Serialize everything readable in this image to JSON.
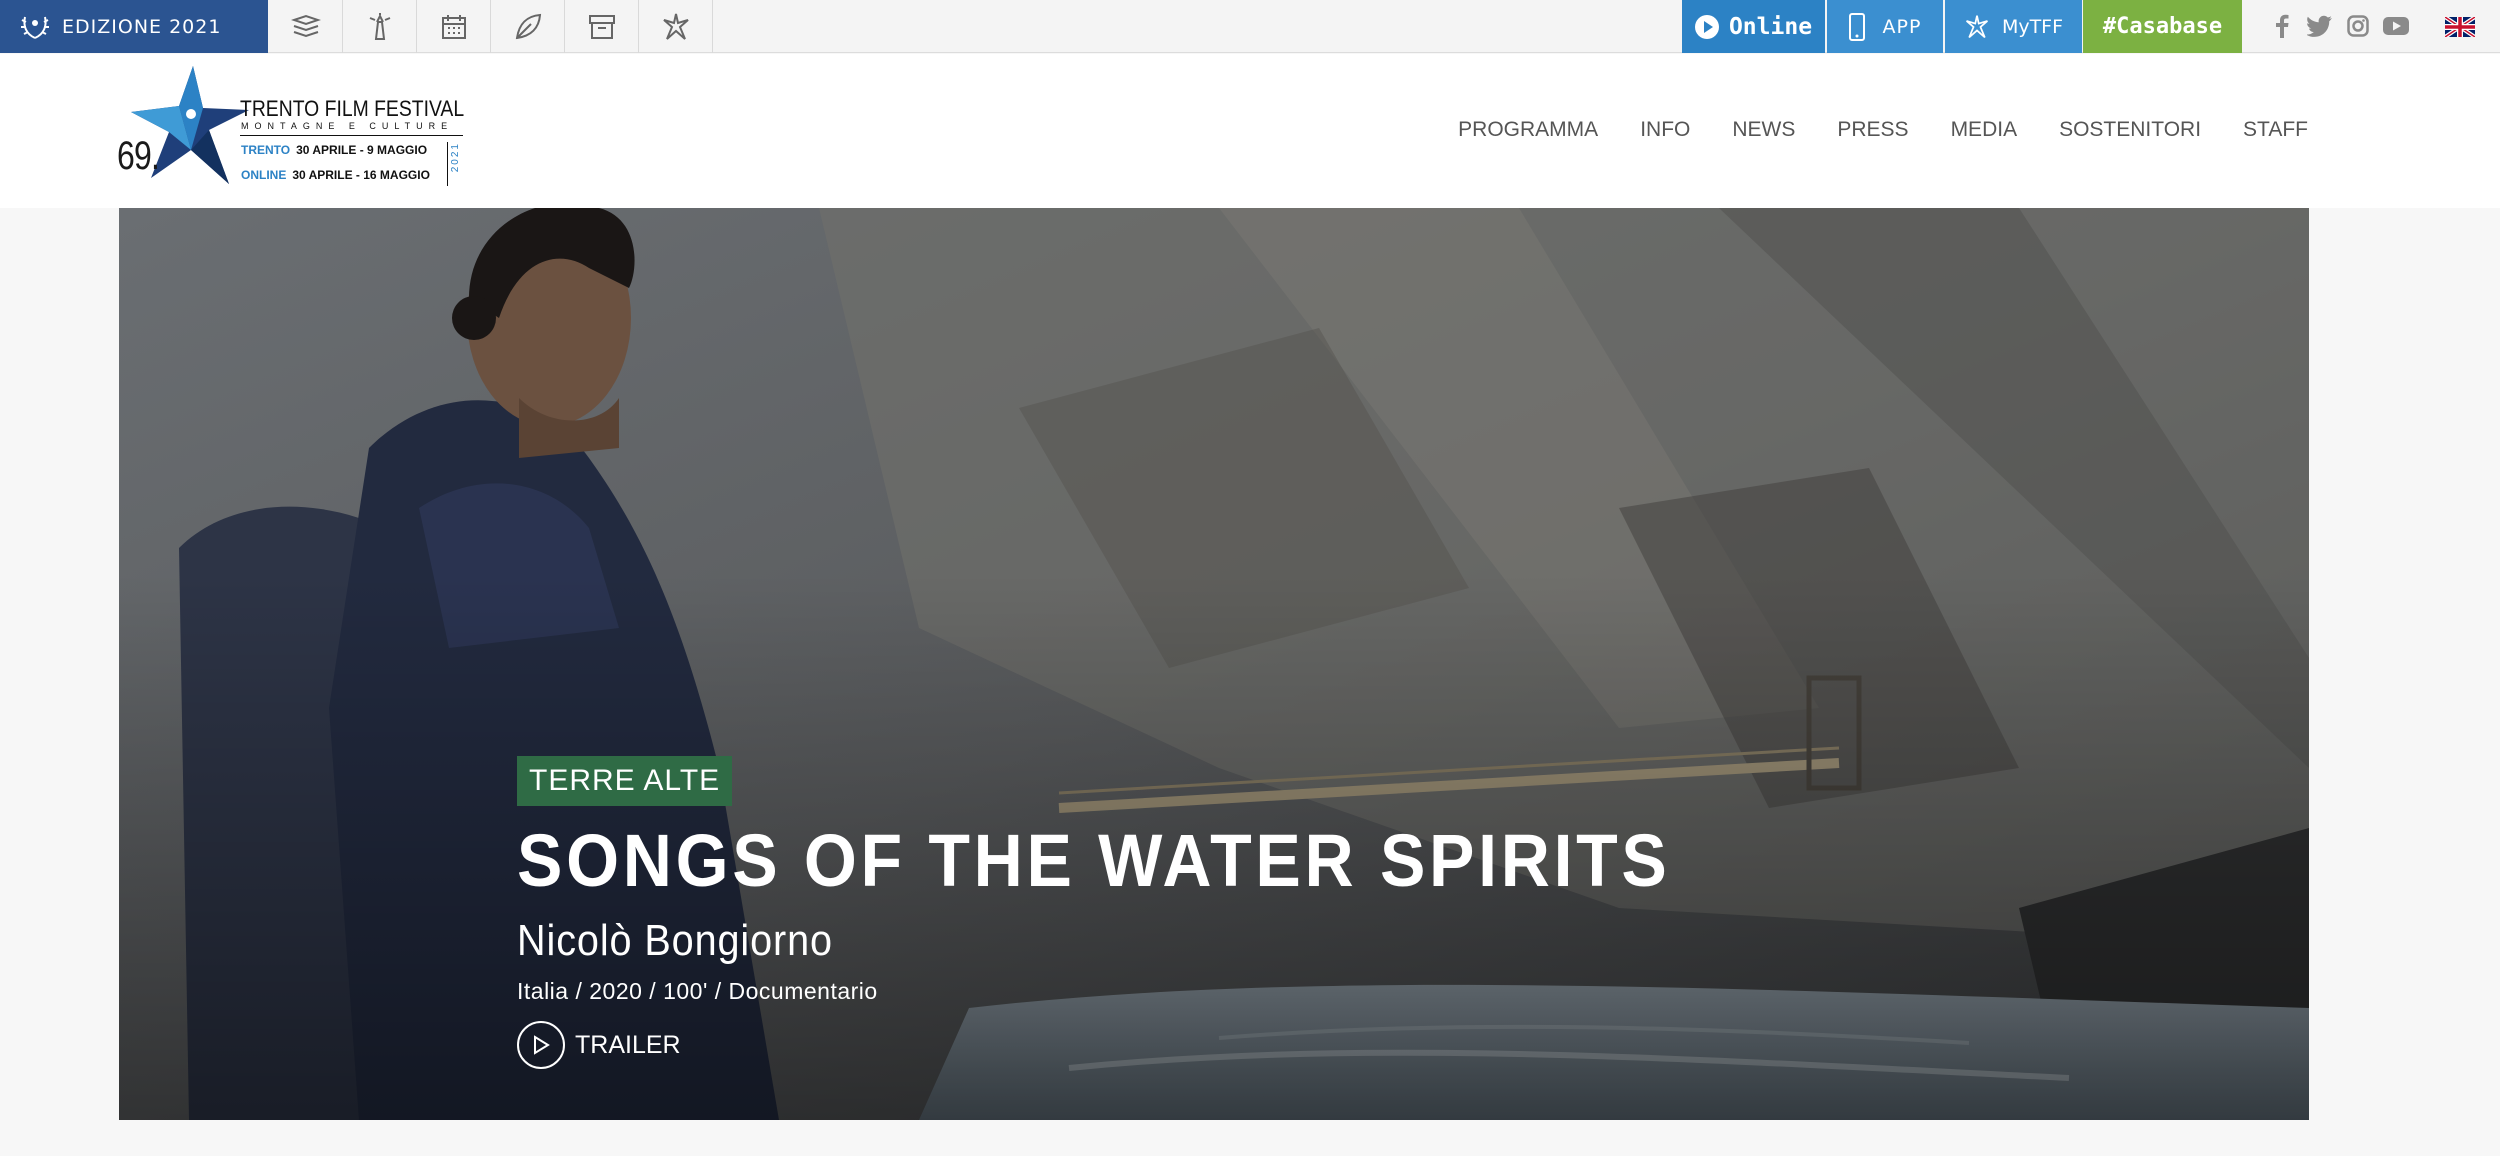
{
  "topbar": {
    "edition_label": "EDIZIONE 2021",
    "icons": [
      "books-icon",
      "lighthouse-icon",
      "calendar-icon",
      "leaf-icon",
      "archive-icon",
      "star-person-icon"
    ],
    "online_label": "Online",
    "app_label": "APP",
    "mytff_label": "MyTFF",
    "casabase_label": "#Casabase",
    "social": [
      "facebook-icon",
      "twitter-icon",
      "instagram-icon",
      "youtube-icon"
    ],
    "language_flag": "uk-flag-icon",
    "colors": {
      "edition_bg": "#2b5491",
      "online_bg": "#2c82c5",
      "app_bg": "#3b8fd0",
      "casabase_bg": "#7cb142"
    }
  },
  "logo": {
    "number": "69.",
    "title": "TRENTO FILM FESTIVAL",
    "subtitle": "MONTAGNE E CULTURE",
    "row1_city": "TRENTO",
    "row1_dates": "30 APRILE - 9 MAGGIO",
    "row2_city": "ONLINE",
    "row2_dates": "30 APRILE - 16 MAGGIO",
    "year": "2021"
  },
  "nav": {
    "items": [
      "PROGRAMMA",
      "INFO",
      "NEWS",
      "PRESS",
      "MEDIA",
      "SOSTENITORI",
      "STAFF"
    ]
  },
  "hero": {
    "category": "TERRE ALTE",
    "title": "SONGS OF THE WATER SPIRITS",
    "director": "Nicolò Bongiorno",
    "meta": "Italia / 2020 / 100' / Documentario",
    "trailer_label": "TRAILER",
    "category_color": "#2f6b45"
  }
}
